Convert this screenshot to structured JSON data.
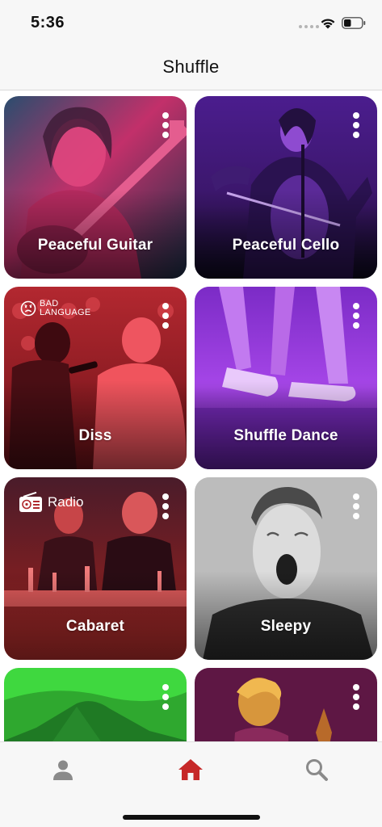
{
  "status_bar": {
    "time": "5:36",
    "wifi_icon": "wifi-icon",
    "battery_icon": "battery-icon"
  },
  "header": {
    "title": "Shuffle"
  },
  "tiles": [
    {
      "label": "Peaceful Guitar",
      "badge": null,
      "color": "#d6336c"
    },
    {
      "label": "Peaceful Cello",
      "badge": null,
      "color": "#5a22a8"
    },
    {
      "label": "Diss",
      "badge": {
        "icon": "frown-face-icon",
        "text": "BAD LANGUAGE"
      },
      "color": "#e8343c"
    },
    {
      "label": "Shuffle Dance",
      "badge": null,
      "color": "#a33ce6"
    },
    {
      "label": "Cabaret",
      "badge": {
        "icon": "radio-icon",
        "text": "Radio"
      },
      "color": "#b42a2e"
    },
    {
      "label": "Sleepy",
      "badge": null,
      "color": "#b8b8b8"
    },
    {
      "label": "",
      "badge": null,
      "color": "#3ec63e"
    },
    {
      "label": "",
      "badge": null,
      "color": "#7a1d5a"
    }
  ],
  "tab_bar": {
    "items": [
      {
        "name": "profile",
        "icon": "person-icon",
        "active": false
      },
      {
        "name": "home",
        "icon": "home-icon",
        "active": true
      },
      {
        "name": "search",
        "icon": "search-icon",
        "active": false
      }
    ],
    "active_color": "#c62828",
    "inactive_color": "#8a8a8a"
  }
}
